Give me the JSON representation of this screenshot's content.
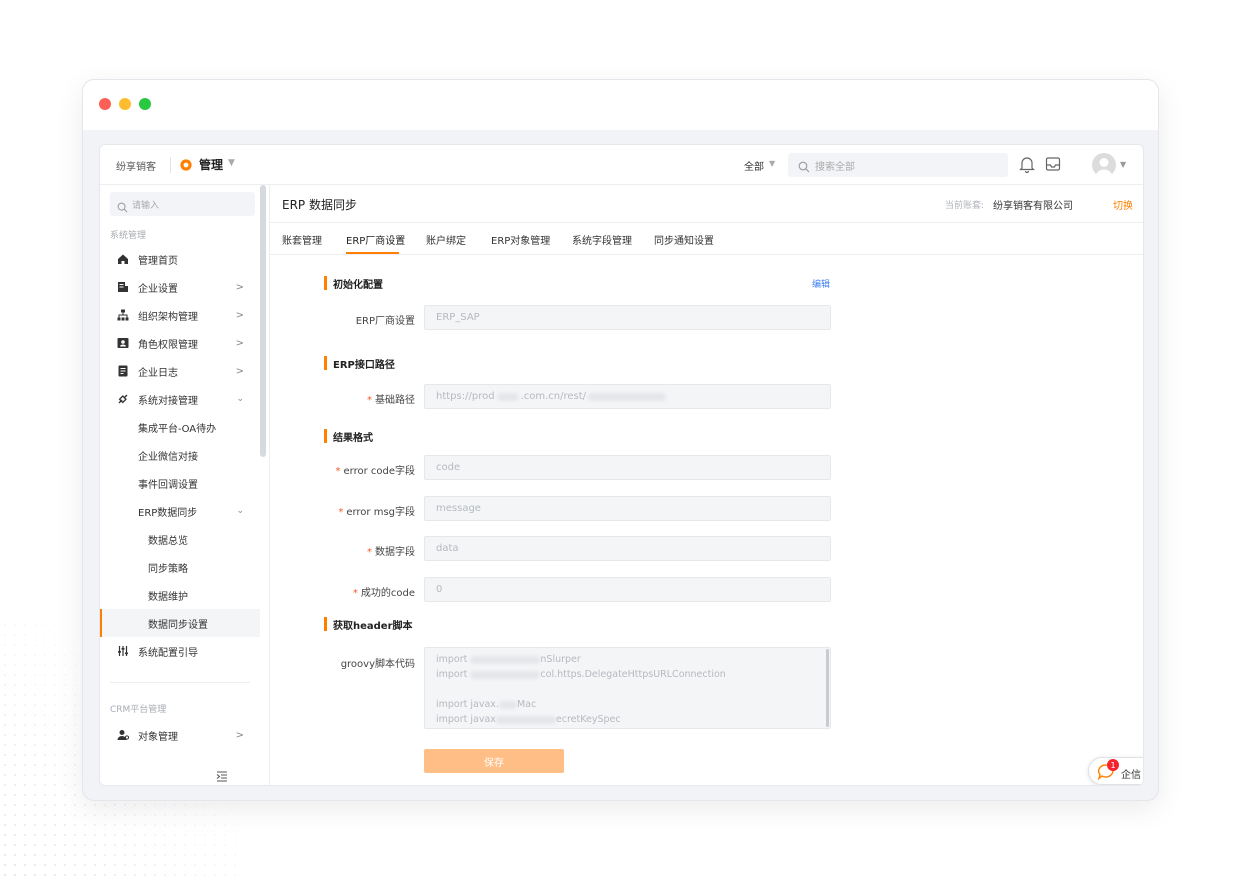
{
  "app": {
    "brand": "纷享销客",
    "module": "管理",
    "search_scope": "全部",
    "search_placeholder": "搜索全部"
  },
  "sidebar": {
    "search_placeholder": "请输入",
    "section_system": "系统管理",
    "items": [
      {
        "label": "管理首页",
        "icon": "home-icon"
      },
      {
        "label": "企业设置",
        "icon": "building-icon"
      },
      {
        "label": "组织架构管理",
        "icon": "org-chart-icon"
      },
      {
        "label": "角色权限管理",
        "icon": "id-card-icon"
      },
      {
        "label": "企业日志",
        "icon": "log-icon"
      },
      {
        "label": "系统对接管理",
        "icon": "link-icon"
      }
    ],
    "sub_items": [
      "集成平台-OA待办",
      "企业微信对接",
      "事件回调设置",
      "ERP数据同步"
    ],
    "erp_sub_items": [
      "数据总览",
      "同步策略",
      "数据维护",
      "数据同步设置"
    ],
    "config_guide": "系统配置引导",
    "section_crm": "CRM平台管理",
    "object_mgmt": "对象管理"
  },
  "header": {
    "title": "ERP 数据同步",
    "account_label": "当前账套:",
    "account_name": "纷享销客有限公司",
    "switch_label": "切换"
  },
  "tabs": [
    "账套管理",
    "ERP厂商设置",
    "账户绑定",
    "ERP对象管理",
    "系统字段管理",
    "同步通知设置"
  ],
  "active_tab": "ERP厂商设置",
  "form": {
    "edit_label": "编辑",
    "sections": {
      "init": "初始化配置",
      "path": "ERP接口路径",
      "result": "结果格式",
      "header": "获取header脚本"
    },
    "fields": {
      "vendor": {
        "label": "ERP厂商设置",
        "value": "ERP_SAP"
      },
      "base_path": {
        "label": "基础路径",
        "value_a": "https://prod",
        "value_b": ".com.cn/rest/"
      },
      "error_code": {
        "label": "error code字段",
        "value": "code"
      },
      "error_msg": {
        "label": "error msg字段",
        "value": "message"
      },
      "data_field": {
        "label": "数据字段",
        "value": "data"
      },
      "success_code": {
        "label": "成功的code",
        "value": "0"
      },
      "groovy": {
        "label": "groovy脚本代码",
        "line1_a": "import",
        "line1_b": "nSlurper",
        "line2_a": "import",
        "line2_b": "col.https.DelegateHttpsURLConnection",
        "line3_a": "import javax.",
        "line3_b": "Mac",
        "line4_a": "import javax",
        "line4_b": "ecretKeySpec"
      }
    },
    "save_label": "保存"
  },
  "chat": {
    "label": "企信",
    "badge": "1"
  },
  "colors": {
    "accent": "#ff8000",
    "link": "#3b7ff5",
    "save": "#ffbe85"
  }
}
